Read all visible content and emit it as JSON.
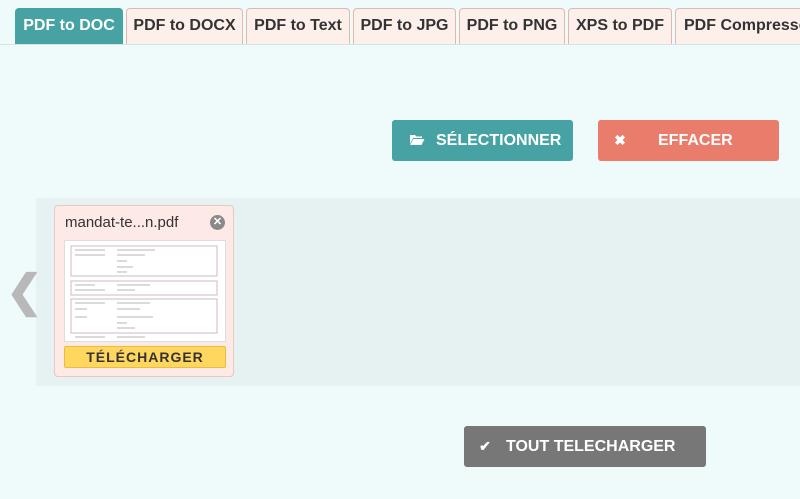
{
  "tabs": [
    {
      "label": "PDF to DOC",
      "active": true
    },
    {
      "label": "PDF to DOCX",
      "active": false
    },
    {
      "label": "PDF to Text",
      "active": false
    },
    {
      "label": "PDF to JPG",
      "active": false
    },
    {
      "label": "PDF to PNG",
      "active": false
    },
    {
      "label": "XPS to PDF",
      "active": false
    },
    {
      "label": "PDF Compressor",
      "active": false
    }
  ],
  "toolbar": {
    "select_label": "SÉLECTIONNER",
    "select_icon": "folder-open-icon",
    "clear_label": "EFFACER",
    "clear_icon": "times-icon"
  },
  "files": [
    {
      "name": "mandat-te...n.pdf",
      "download_label": "TÉLÉCHARGER",
      "remove_icon": "close-circle-icon"
    }
  ],
  "carousel": {
    "prev_icon": "chevron-left-icon"
  },
  "footer": {
    "download_all_label": "TOUT TELECHARGER",
    "download_all_icon": "check-icon"
  },
  "colors": {
    "accent": "#47a3a3",
    "danger": "#e97c6b",
    "neutral": "#777777",
    "download": "#ffd75e",
    "background": "#effafa"
  }
}
